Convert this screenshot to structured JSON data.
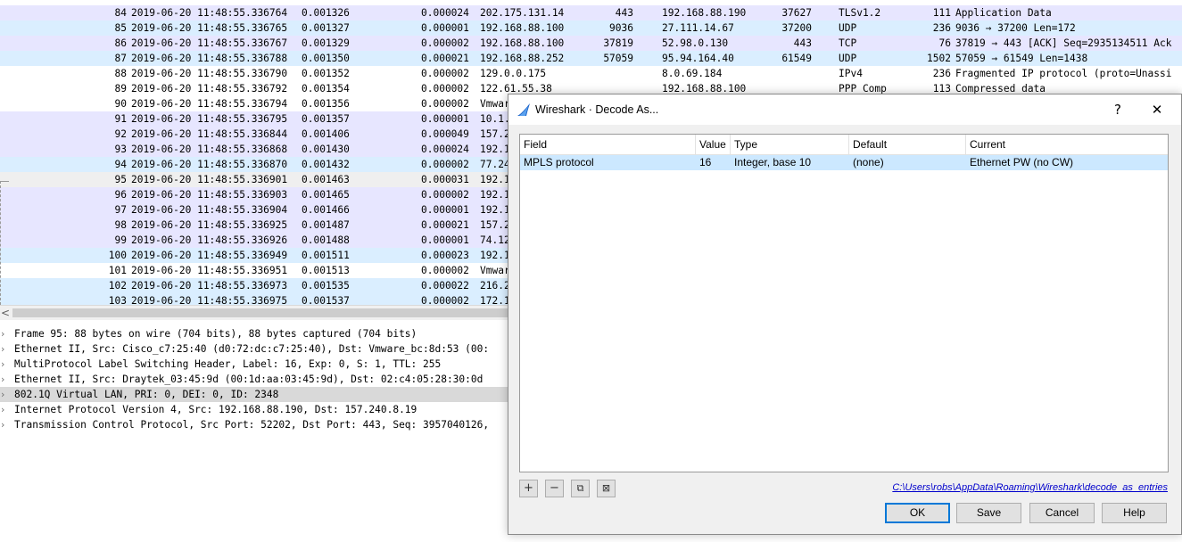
{
  "packets": [
    {
      "no": "84",
      "time": "2019-06-20 11:48:55.336764",
      "rel": "0.001326",
      "delta": "0.000024",
      "src": "202.175.131.14",
      "sport": "443",
      "dst": "192.168.88.190",
      "dport": "37627",
      "proto": "TLSv1.2",
      "len": "111",
      "info": "Application Data",
      "bg": "#e7e6ff"
    },
    {
      "no": "85",
      "time": "2019-06-20 11:48:55.336765",
      "rel": "0.001327",
      "delta": "0.000001",
      "src": "192.168.88.100",
      "sport": "9036",
      "dst": "27.111.14.67",
      "dport": "37200",
      "proto": "UDP",
      "len": "236",
      "info": "9036 → 37200 Len=172",
      "bg": "#daeeff"
    },
    {
      "no": "86",
      "time": "2019-06-20 11:48:55.336767",
      "rel": "0.001329",
      "delta": "0.000002",
      "src": "192.168.88.100",
      "sport": "37819",
      "dst": "52.98.0.130",
      "dport": "443",
      "proto": "TCP",
      "len": "76",
      "info": "37819 → 443 [ACK] Seq=2935134511 Ack",
      "bg": "#e7e6ff"
    },
    {
      "no": "87",
      "time": "2019-06-20 11:48:55.336788",
      "rel": "0.001350",
      "delta": "0.000021",
      "src": "192.168.88.252",
      "sport": "57059",
      "dst": "95.94.164.40",
      "dport": "61549",
      "proto": "UDP",
      "len": "1502",
      "info": "57059 → 61549 Len=1438",
      "bg": "#daeeff"
    },
    {
      "no": "88",
      "time": "2019-06-20 11:48:55.336790",
      "rel": "0.001352",
      "delta": "0.000002",
      "src": "129.0.0.175",
      "sport": "",
      "dst": "8.0.69.184",
      "dport": "",
      "proto": "IPv4",
      "len": "236",
      "info": "Fragmented IP protocol (proto=Unassi",
      "bg": "#ffffff"
    },
    {
      "no": "89",
      "time": "2019-06-20 11:48:55.336792",
      "rel": "0.001354",
      "delta": "0.000002",
      "src": "122.61.55.38",
      "sport": "",
      "dst": "192.168.88.100",
      "dport": "",
      "proto": "PPP Comp",
      "len": "113",
      "info": "Compressed data",
      "bg": "#ffffff"
    },
    {
      "no": "90",
      "time": "2019-06-20 11:48:55.336794",
      "rel": "0.001356",
      "delta": "0.000002",
      "src": "Vmwar",
      "sport": "",
      "dst": "",
      "dport": "",
      "proto": "",
      "len": "",
      "info": "",
      "bg": "#ffffff"
    },
    {
      "no": "91",
      "time": "2019-06-20 11:48:55.336795",
      "rel": "0.001357",
      "delta": "0.000001",
      "src": "10.1.",
      "sport": "",
      "dst": "",
      "dport": "",
      "proto": "",
      "len": "",
      "info": "",
      "bg": "#e7e6ff"
    },
    {
      "no": "92",
      "time": "2019-06-20 11:48:55.336844",
      "rel": "0.001406",
      "delta": "0.000049",
      "src": "157.2",
      "sport": "",
      "dst": "",
      "dport": "",
      "proto": "",
      "len": "",
      "info": "",
      "bg": "#e7e6ff"
    },
    {
      "no": "93",
      "time": "2019-06-20 11:48:55.336868",
      "rel": "0.001430",
      "delta": "0.000024",
      "src": "192.1",
      "sport": "",
      "dst": "",
      "dport": "",
      "proto": "",
      "len": "",
      "info": "",
      "bg": "#e7e6ff"
    },
    {
      "no": "94",
      "time": "2019-06-20 11:48:55.336870",
      "rel": "0.001432",
      "delta": "0.000002",
      "src": "77.24",
      "sport": "",
      "dst": "",
      "dport": "",
      "proto": "",
      "len": "",
      "info": "",
      "bg": "#daeeff"
    },
    {
      "no": "95",
      "time": "2019-06-20 11:48:55.336901",
      "rel": "0.001463",
      "delta": "0.000031",
      "src": "192.1",
      "sport": "",
      "dst": "",
      "dport": "",
      "proto": "",
      "len": "",
      "info": "",
      "bg": "#efefef"
    },
    {
      "no": "96",
      "time": "2019-06-20 11:48:55.336903",
      "rel": "0.001465",
      "delta": "0.000002",
      "src": "192.1",
      "sport": "",
      "dst": "",
      "dport": "",
      "proto": "",
      "len": "",
      "info": "",
      "bg": "#e7e6ff"
    },
    {
      "no": "97",
      "time": "2019-06-20 11:48:55.336904",
      "rel": "0.001466",
      "delta": "0.000001",
      "src": "192.1",
      "sport": "",
      "dst": "",
      "dport": "",
      "proto": "",
      "len": "",
      "info": "",
      "bg": "#e7e6ff"
    },
    {
      "no": "98",
      "time": "2019-06-20 11:48:55.336925",
      "rel": "0.001487",
      "delta": "0.000021",
      "src": "157.2",
      "sport": "",
      "dst": "",
      "dport": "",
      "proto": "",
      "len": "",
      "info": "",
      "bg": "#e7e6ff"
    },
    {
      "no": "99",
      "time": "2019-06-20 11:48:55.336926",
      "rel": "0.001488",
      "delta": "0.000001",
      "src": "74.12",
      "sport": "",
      "dst": "",
      "dport": "",
      "proto": "",
      "len": "",
      "info": "",
      "bg": "#e7e6ff"
    },
    {
      "no": "100",
      "time": "2019-06-20 11:48:55.336949",
      "rel": "0.001511",
      "delta": "0.000023",
      "src": "192.1",
      "sport": "",
      "dst": "",
      "dport": "",
      "proto": "",
      "len": "",
      "info": "",
      "bg": "#daeeff"
    },
    {
      "no": "101",
      "time": "2019-06-20 11:48:55.336951",
      "rel": "0.001513",
      "delta": "0.000002",
      "src": "Vmwar",
      "sport": "",
      "dst": "",
      "dport": "",
      "proto": "",
      "len": "",
      "info": "",
      "bg": "#ffffff"
    },
    {
      "no": "102",
      "time": "2019-06-20 11:48:55.336973",
      "rel": "0.001535",
      "delta": "0.000022",
      "src": "216.2",
      "sport": "",
      "dst": "",
      "dport": "",
      "proto": "",
      "len": "",
      "info": "",
      "bg": "#daeeff"
    },
    {
      "no": "103",
      "time": "2019-06-20 11:48:55.336975",
      "rel": "0.001537",
      "delta": "0.000002",
      "src": "172.1",
      "sport": "",
      "dst": "",
      "dport": "",
      "proto": "",
      "len": "",
      "info": "",
      "bg": "#daeeff"
    }
  ],
  "scrollbar": {
    "left_arrow": "<"
  },
  "details": [
    {
      "text": "Frame 95: 88 bytes on wire (704 bits), 88 bytes captured (704 bits)",
      "selected": false
    },
    {
      "text": "Ethernet II, Src: Cisco_c7:25:40 (d0:72:dc:c7:25:40), Dst: Vmware_bc:8d:53 (00:",
      "selected": false
    },
    {
      "text": "MultiProtocol Label Switching Header, Label: 16, Exp: 0, S: 1, TTL: 255",
      "selected": false
    },
    {
      "text": "Ethernet II, Src: Draytek_03:45:9d (00:1d:aa:03:45:9d), Dst: 02:c4:05:28:30:0d",
      "selected": false
    },
    {
      "text": "802.1Q Virtual LAN, PRI: 0, DEI: 0, ID: 2348",
      "selected": true
    },
    {
      "text": "Internet Protocol Version 4, Src: 192.168.88.190, Dst: 157.240.8.19",
      "selected": false
    },
    {
      "text": "Transmission Control Protocol, Src Port: 52202, Dst Port: 443, Seq: 3957040126,",
      "selected": false
    }
  ],
  "dialog": {
    "title": "Wireshark · Decode As...",
    "help_glyph": "?",
    "close_glyph": "✕",
    "columns": {
      "field": "Field",
      "value": "Value",
      "type": "Type",
      "default": "Default",
      "current": "Current"
    },
    "rows": [
      {
        "field": "MPLS protocol",
        "value": "16",
        "type": "Integer, base 10",
        "default": "(none)",
        "current": "Ethernet PW (no CW)"
      }
    ],
    "toolbar": {
      "add": "+",
      "remove": "−",
      "copy": "⧉",
      "clear": "⊠"
    },
    "path_link": "C:\\Users\\robs\\AppData\\Roaming\\Wireshark\\decode_as_entries",
    "buttons": {
      "ok": "OK",
      "save": "Save",
      "cancel": "Cancel",
      "help": "Help"
    }
  }
}
